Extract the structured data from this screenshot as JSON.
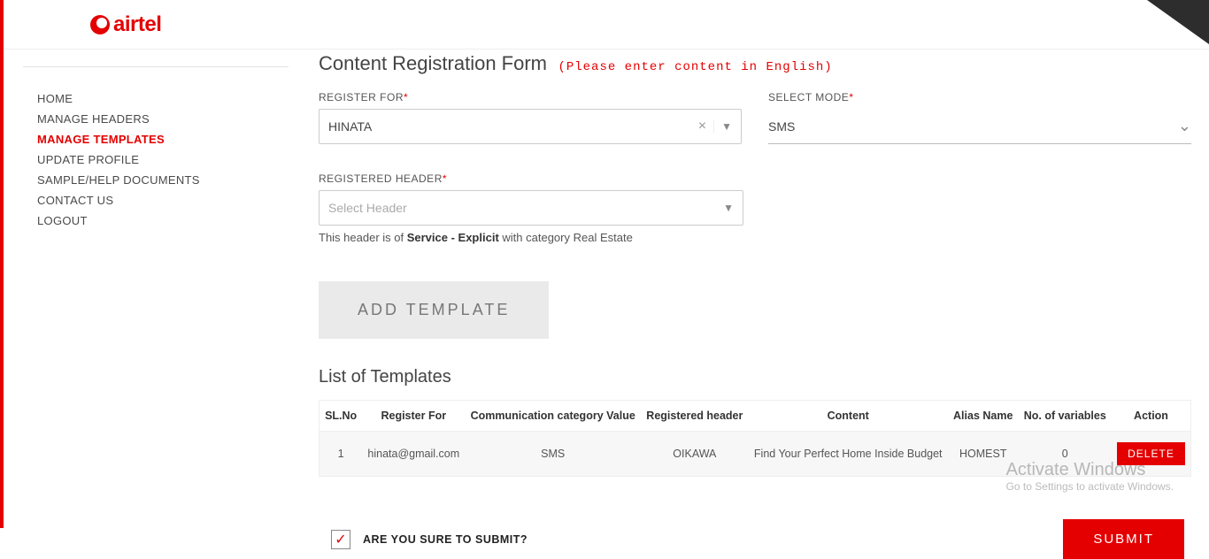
{
  "brand": "airtel",
  "sidebar": {
    "items": [
      {
        "label": "HOME"
      },
      {
        "label": "MANAGE HEADERS"
      },
      {
        "label": "MANAGE TEMPLATES"
      },
      {
        "label": "UPDATE PROFILE"
      },
      {
        "label": "SAMPLE/HELP DOCUMENTS"
      },
      {
        "label": "CONTACT US"
      },
      {
        "label": "LOGOUT"
      }
    ],
    "activeIndex": 2
  },
  "form": {
    "title": "Content Registration Form",
    "hint": "(Please enter content in English)",
    "registerFor": {
      "label": "REGISTER FOR",
      "value": "HINATA"
    },
    "selectMode": {
      "label": "SELECT MODE",
      "value": "SMS"
    },
    "registeredHeader": {
      "label": "REGISTERED HEADER",
      "placeholder": "Select Header",
      "note_prefix": "This header is of ",
      "note_bold": "Service - Explicit",
      "note_suffix": " with category Real Estate"
    },
    "addTemplateLabel": "ADD TEMPLATE",
    "listTitle": "List of Templates",
    "columns": [
      "SL.No",
      "Register For",
      "Communication category Value",
      "Registered header",
      "Content",
      "Alias Name",
      "No. of variables",
      "Action"
    ],
    "rows": [
      {
        "sl": "1",
        "registerFor": "hinata@gmail.com",
        "comm": "SMS",
        "header": "OIKAWA",
        "content": "Find Your Perfect Home Inside Budget",
        "alias": "HOMEST",
        "vars": "0",
        "action": "DELETE"
      }
    ],
    "confirmLabel": "ARE YOU SURE TO SUBMIT?",
    "confirmChecked": true,
    "submitLabel": "SUBMIT"
  },
  "watermark": {
    "line1": "Activate Windows",
    "line2": "Go to Settings to activate Windows."
  }
}
